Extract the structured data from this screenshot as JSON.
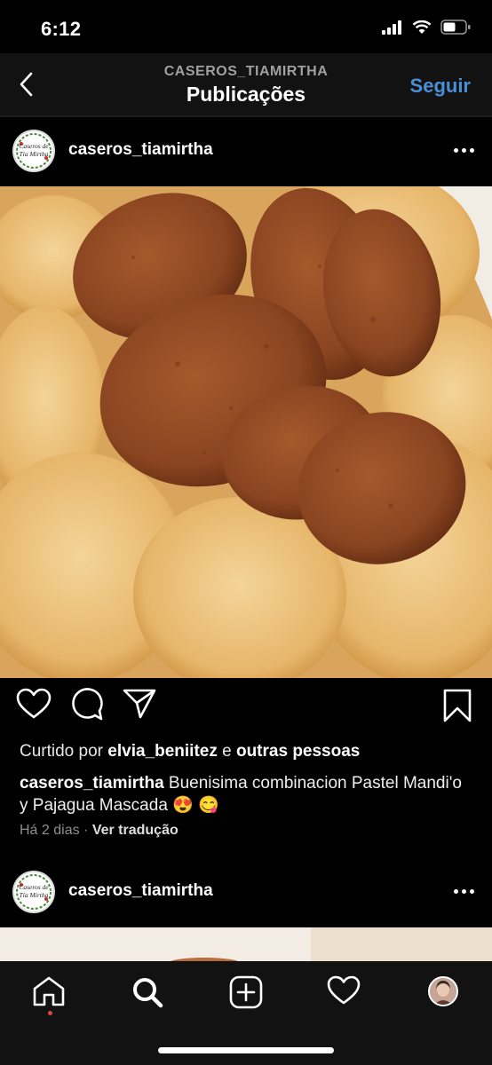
{
  "status": {
    "time": "6:12"
  },
  "header": {
    "subtitle": "CASEROS_TIAMIRTHA",
    "title": "Publicações",
    "follow_label": "Seguir",
    "follow_color": "#4a8fd6"
  },
  "post": {
    "username": "caseros_tiamirtha",
    "logo_line1": "Caseros de",
    "logo_line2": "Tía Mirtha",
    "likes_prefix": "Curtido por ",
    "likes_user": "elvia_beniitez",
    "likes_mid": " e ",
    "likes_suffix": "outras pessoas",
    "caption_user": "caseros_tiamirtha",
    "caption_text": " Buenisima combinacion Pastel Mandi'o y Pajagua Mascada 😍 😋",
    "time_ago": "Há 2 dias",
    "separator": " · ",
    "translate_label": "Ver tradução"
  },
  "post2": {
    "username": "caseros_tiamirtha",
    "logo_line1": "Caseros de",
    "logo_line2": "Tía Mirtha"
  },
  "tabs": [
    "home-icon",
    "search-icon",
    "add-icon",
    "heart-icon",
    "profile-avatar"
  ]
}
